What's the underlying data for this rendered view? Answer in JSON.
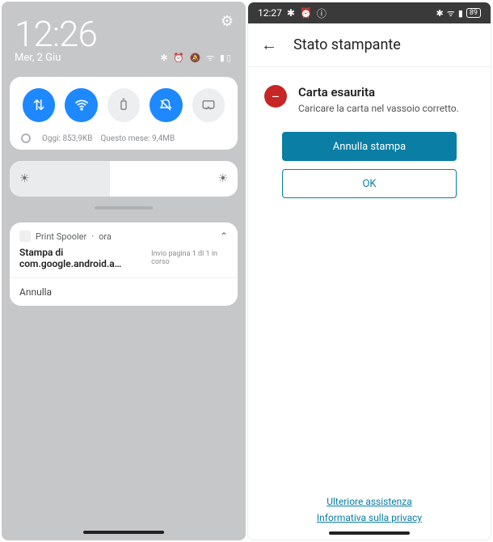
{
  "left": {
    "time": "12:26",
    "date": "Mer, 2 Giu",
    "status_icons_text": "✱ ⏰ 🔕 ᯤ ▮▯",
    "qs": {
      "today_label": "Oggi: 853,9KB",
      "month_label": "Questo mese: 9,4MB"
    },
    "notif": {
      "app": "Print Spooler",
      "time": "ora",
      "title": "Stampa di com.google.android.a…",
      "sub": "Invio pagina 1 di 1 in corso",
      "action": "Annulla"
    }
  },
  "right": {
    "status_time": "12:27",
    "battery": "89",
    "header_title": "Stato stampante",
    "alert_title": "Carta esaurita",
    "alert_sub": "Caricare la carta nel vassoio corretto.",
    "btn_cancel": "Annulla stampa",
    "btn_ok": "OK",
    "link_help": "Ulteriore assistenza",
    "link_privacy": "Informativa sulla privacy"
  }
}
